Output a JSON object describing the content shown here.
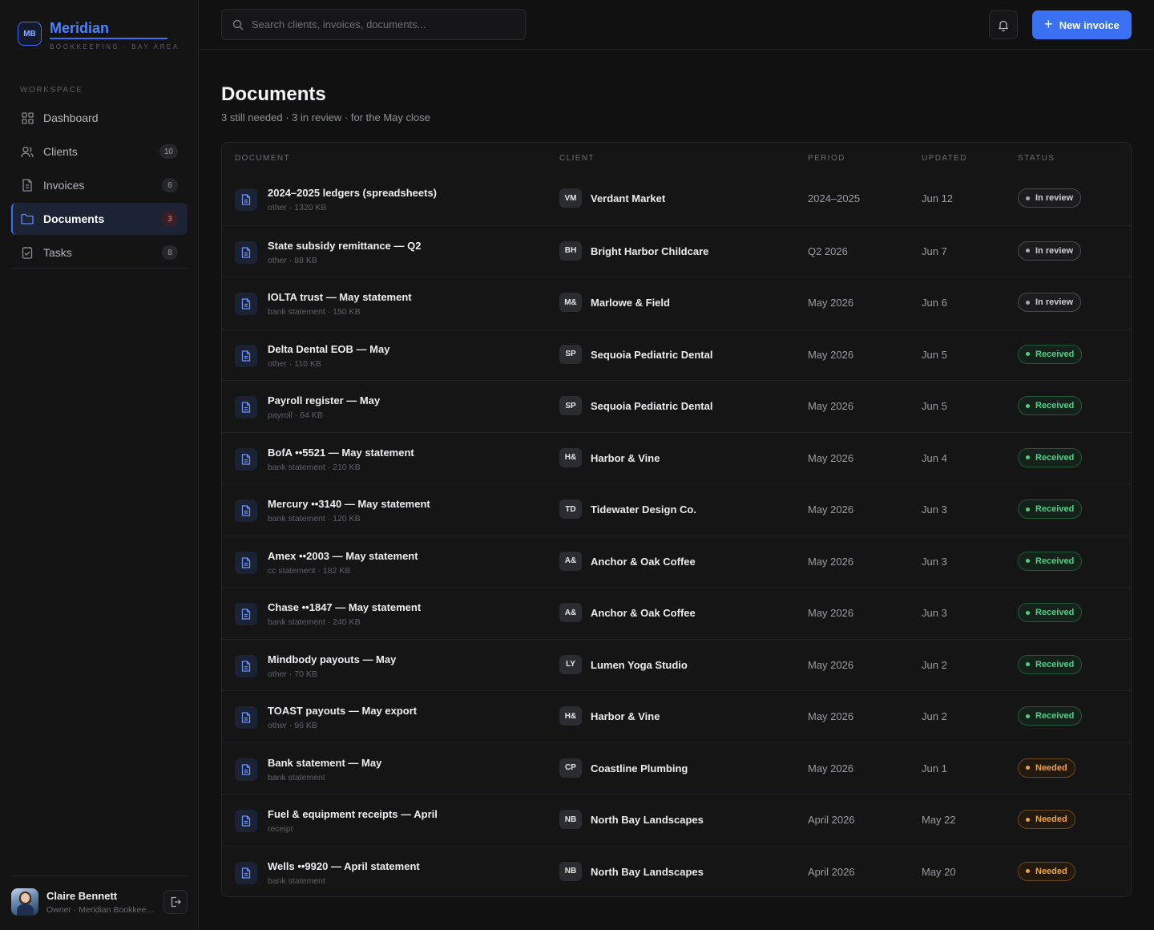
{
  "brand": {
    "mark": "MB",
    "name": "Meridian",
    "tagline": "BOOKKEEPING · BAY AREA"
  },
  "sidebar": {
    "section_label": "WORKSPACE",
    "items": [
      {
        "label": "Dashboard",
        "icon": "grid-icon",
        "count": "",
        "active": false
      },
      {
        "label": "Clients",
        "icon": "users-icon",
        "count": "10",
        "active": false
      },
      {
        "label": "Invoices",
        "icon": "invoice-icon",
        "count": "6",
        "active": false
      },
      {
        "label": "Documents",
        "icon": "folder-icon",
        "count": "3",
        "active": true
      },
      {
        "label": "Tasks",
        "icon": "tasks-icon",
        "count": "8",
        "active": false
      }
    ]
  },
  "user": {
    "name": "Claire Bennett",
    "role": "Owner · Meridian Bookkeeping"
  },
  "topbar": {
    "search_placeholder": "Search clients, invoices, documents...",
    "new_invoice_label": "New invoice"
  },
  "page": {
    "title": "Documents",
    "subtitle": "3 still needed · 3 in review · for the May close"
  },
  "table": {
    "headers": {
      "document": "DOCUMENT",
      "client": "CLIENT",
      "period": "PERIOD",
      "updated": "UPDATED",
      "status": "STATUS"
    },
    "rows": [
      {
        "title": "2024–2025 ledgers (spreadsheets)",
        "meta": "other · 1320 KB",
        "badge": "VM",
        "client": "Verdant Market",
        "period": "2024–2025",
        "updated": "Jun 12",
        "status": "In review",
        "status_type": "review"
      },
      {
        "title": "State subsidy remittance — Q2",
        "meta": "other · 88 KB",
        "badge": "BH",
        "client": "Bright Harbor Childcare",
        "period": "Q2 2026",
        "updated": "Jun 7",
        "status": "In review",
        "status_type": "review"
      },
      {
        "title": "IOLTA trust — May statement",
        "meta": "bank statement · 150 KB",
        "badge": "M&",
        "client": "Marlowe & Field",
        "period": "May 2026",
        "updated": "Jun 6",
        "status": "In review",
        "status_type": "review"
      },
      {
        "title": "Delta Dental EOB — May",
        "meta": "other · 110 KB",
        "badge": "SP",
        "client": "Sequoia Pediatric Dental",
        "period": "May 2026",
        "updated": "Jun 5",
        "status": "Received",
        "status_type": "received"
      },
      {
        "title": "Payroll register — May",
        "meta": "payroll · 64 KB",
        "badge": "SP",
        "client": "Sequoia Pediatric Dental",
        "period": "May 2026",
        "updated": "Jun 5",
        "status": "Received",
        "status_type": "received"
      },
      {
        "title": "BofA ••5521 — May statement",
        "meta": "bank statement · 210 KB",
        "badge": "H&",
        "client": "Harbor & Vine",
        "period": "May 2026",
        "updated": "Jun 4",
        "status": "Received",
        "status_type": "received"
      },
      {
        "title": "Mercury ••3140 — May statement",
        "meta": "bank statement · 120 KB",
        "badge": "TD",
        "client": "Tidewater Design Co.",
        "period": "May 2026",
        "updated": "Jun 3",
        "status": "Received",
        "status_type": "received"
      },
      {
        "title": "Amex ••2003 — May statement",
        "meta": "cc statement · 182 KB",
        "badge": "A&",
        "client": "Anchor & Oak Coffee",
        "period": "May 2026",
        "updated": "Jun 3",
        "status": "Received",
        "status_type": "received"
      },
      {
        "title": "Chase ••1847 — May statement",
        "meta": "bank statement · 240 KB",
        "badge": "A&",
        "client": "Anchor & Oak Coffee",
        "period": "May 2026",
        "updated": "Jun 3",
        "status": "Received",
        "status_type": "received"
      },
      {
        "title": "Mindbody payouts — May",
        "meta": "other · 70 KB",
        "badge": "LY",
        "client": "Lumen Yoga Studio",
        "period": "May 2026",
        "updated": "Jun 2",
        "status": "Received",
        "status_type": "received"
      },
      {
        "title": "TOAST payouts — May export",
        "meta": "other · 96 KB",
        "badge": "H&",
        "client": "Harbor & Vine",
        "period": "May 2026",
        "updated": "Jun 2",
        "status": "Received",
        "status_type": "received"
      },
      {
        "title": "Bank statement — May",
        "meta": "bank statement",
        "badge": "CP",
        "client": "Coastline Plumbing",
        "period": "May 2026",
        "updated": "Jun 1",
        "status": "Needed",
        "status_type": "needed"
      },
      {
        "title": "Fuel & equipment receipts — April",
        "meta": "receipt",
        "badge": "NB",
        "client": "North Bay Landscapes",
        "period": "April 2026",
        "updated": "May 22",
        "status": "Needed",
        "status_type": "needed"
      },
      {
        "title": "Wells ••9920 — April statement",
        "meta": "bank statement",
        "badge": "NB",
        "client": "North Bay Landscapes",
        "period": "April 2026",
        "updated": "May 20",
        "status": "Needed",
        "status_type": "needed"
      }
    ]
  },
  "colors": {
    "accent": "#3a70f2",
    "received": "#4fd18a",
    "needed": "#f0a444",
    "review": "#cfd0d4"
  }
}
